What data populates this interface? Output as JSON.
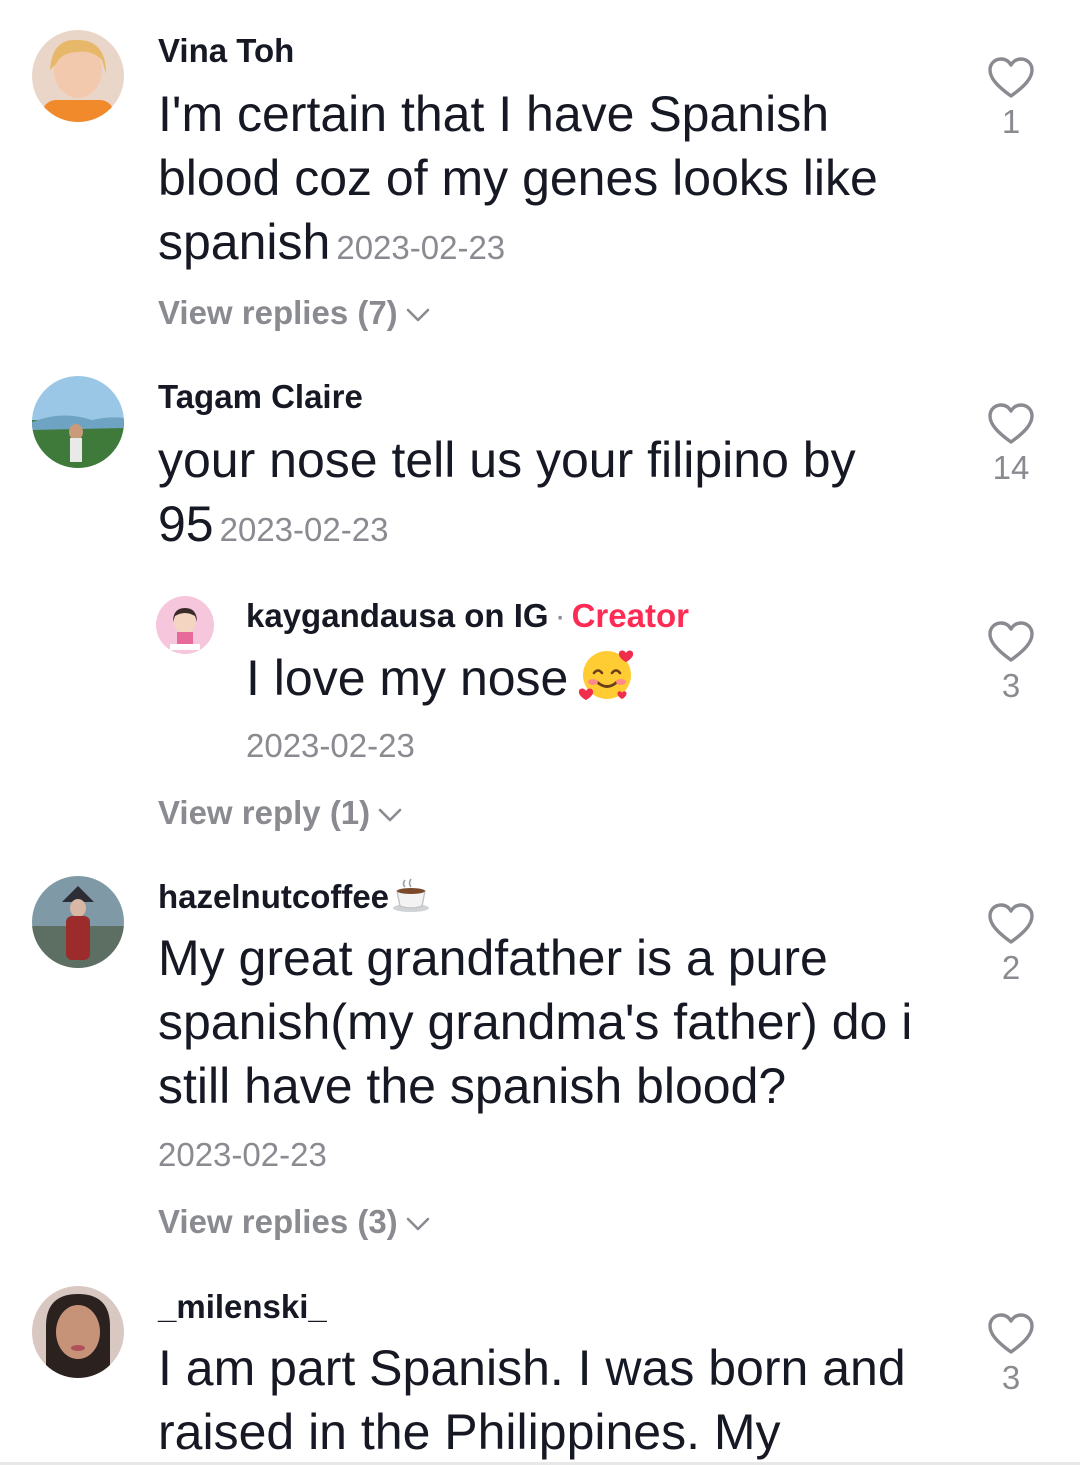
{
  "comments": [
    {
      "username": "Vina Toh",
      "text": "I'm certain that I have Spanish blood coz of my genes looks like spanish",
      "date": "2023-02-23",
      "likes": "1",
      "view_replies": "View replies (7)"
    },
    {
      "username": "Tagam Claire",
      "text": "your nose tell us your filipino by 95",
      "date": "2023-02-23",
      "likes": "14",
      "reply": {
        "username": "kaygandausa on IG",
        "separator": "·",
        "badge": "Creator",
        "text": "I love my nose",
        "emoji": "smiling-face-with-hearts",
        "date": "2023-02-23",
        "likes": "3"
      },
      "view_replies": "View reply (1)"
    },
    {
      "username": "hazelnutcoffee",
      "username_emoji": "coffee-cup",
      "text": "My great grandfather is a pure spanish(my grandma's father) do i still have the spanish blood?",
      "date": "2023-02-23",
      "likes": "2",
      "view_replies": "View replies (3)"
    },
    {
      "username": "_milenski_",
      "text": "I am part Spanish. I was born and raised in the Philippines. My",
      "likes": "3"
    }
  ],
  "colors": {
    "text": "#161823",
    "muted": "#8a8b91",
    "creator": "#fe2c55"
  }
}
